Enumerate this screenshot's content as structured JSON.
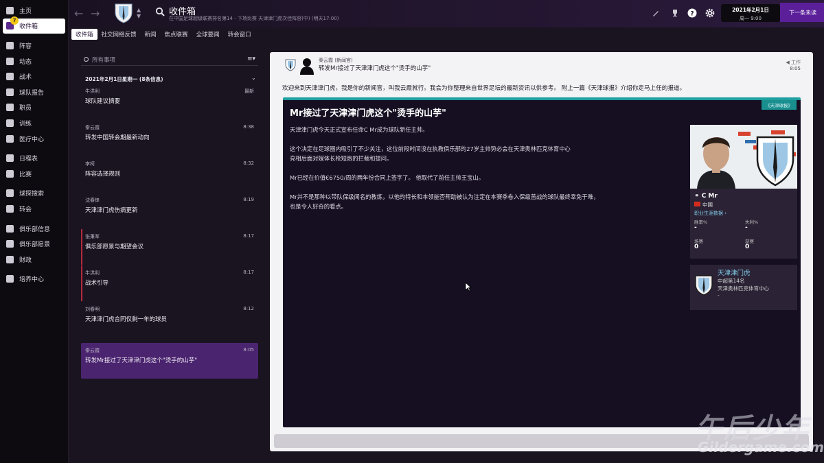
{
  "sidebar": {
    "items": [
      {
        "label": "主页",
        "icon": "home-icon"
      },
      {
        "label": "收件箱",
        "icon": "inbox-icon",
        "active": true,
        "badge": "7"
      },
      {
        "label": "阵容",
        "icon": "squad-icon"
      },
      {
        "label": "动态",
        "icon": "dynamics-icon"
      },
      {
        "label": "战术",
        "icon": "tactics-icon"
      },
      {
        "label": "球队报告",
        "icon": "report-icon"
      },
      {
        "label": "职员",
        "icon": "staff-icon"
      },
      {
        "label": "训练",
        "icon": "training-icon"
      },
      {
        "label": "医疗中心",
        "icon": "medical-icon"
      },
      {
        "label": "日程表",
        "icon": "schedule-icon"
      },
      {
        "label": "比赛",
        "icon": "trophy-icon"
      },
      {
        "label": "球探搜索",
        "icon": "scouting-icon"
      },
      {
        "label": "转会",
        "icon": "transfer-icon"
      },
      {
        "label": "俱乐部信息",
        "icon": "club-info-icon"
      },
      {
        "label": "俱乐部愿景",
        "icon": "vision-icon"
      },
      {
        "label": "财政",
        "icon": "finance-icon"
      },
      {
        "label": "培养中心",
        "icon": "development-icon"
      }
    ]
  },
  "topbar": {
    "title": "收件箱",
    "subtitle": "在中国足球超级联赛排名第14 - 下场比赛 天津津门虎次佳阵容(中) (明天17:00)",
    "date": "2021年2月1日",
    "time": "周一 9:00",
    "continue_label": "下一条未读"
  },
  "tabs": [
    "收件箱",
    "社交网络反馈",
    "新闻",
    "焦点联赛",
    "全球要闻",
    "转会窗口"
  ],
  "inbox": {
    "search_placeholder": "所有事项",
    "group_label": "2021年2月1日星期一 (8条信息)",
    "messages": [
      {
        "sender": "牛洪利",
        "time": "最新",
        "subject": "球队建议摘要"
      },
      {
        "sender": "秦云霞",
        "time": "8:38",
        "subject": "转发中国转会期最新动向"
      },
      {
        "sender": "李柯",
        "time": "8:32",
        "subject": "阵容选择规则"
      },
      {
        "sender": "沈春锋",
        "time": "8:19",
        "subject": "天津津门虎伤病更新"
      },
      {
        "sender": "张秉军",
        "time": "8:17",
        "subject": "俱乐部愿景与期望会议"
      },
      {
        "sender": "牛洪利",
        "time": "8:17",
        "subject": "战术引导"
      },
      {
        "sender": "刘春明",
        "time": "8:12",
        "subject": "天津津门虎合同仅剩一年的球员"
      },
      {
        "sender": "秦云霞",
        "time": "8:05",
        "subject": "转发Mr接过了天津津门虎这个\"烫手的山芋\""
      }
    ]
  },
  "reader": {
    "from": "秦云霞 (新闻官)",
    "subject": "转发Mr接过了天津津门虎这个\"烫手的山芋\"",
    "tag": "工作",
    "time": "8:05",
    "intro": "欢迎来到天津津门虎，我是你的新闻官，叫我云霞就行。我会为你整理来自世界足坛的最新资讯以供参考。 附上一篇《天津球报》介绍你走马上任的报道。",
    "article": {
      "source": "《天津球报》",
      "title": "Mr接过了天津津门虎这个\"烫手的山芋\"",
      "paragraphs": [
        "天津津门虎今天正式宣布任命C Mr成为球队新任主帅。",
        "这个决定在足球圈内吸引了不少关注，这位前段时间没在执教俱乐部的27岁主帅势必会在天津奥林匹克体育中心",
        "亮相后面对媒体长枪短炮的拦截和提问。",
        "Mr已经在价值€6750/周的两年份合同上签字了。 他取代了前任主帅王宝山。",
        "Mr并不是那种以带队保级闻名的教练，以他的特长和本领能否帮助被认为注定在本赛季卷入保级苦战的球队最终幸免于难，",
        "也是令人好奇的看点。"
      ]
    },
    "player": {
      "name": "C Mr",
      "country": "中国",
      "stats_link": "职业生涯数据",
      "win_label": "胜率%",
      "win_value": "-",
      "loss_label": "失利%",
      "loss_value": "-",
      "played_label": "场赛",
      "played_value": "0",
      "won_label": "获赛",
      "won_value": "0"
    },
    "club": {
      "name": "天津津门虎",
      "position": "中超第14名",
      "stadium": "天津奥林匹克体育中心",
      "extra": "-"
    }
  },
  "watermark": {
    "line1": "午后少年",
    "line2": "Gildergame.com"
  },
  "colors": {
    "accent": "#5b1f9a",
    "selected": "#4b2470",
    "teal": "#1fa0a0",
    "unread": "#b8283c",
    "link": "#7fc6e5"
  }
}
